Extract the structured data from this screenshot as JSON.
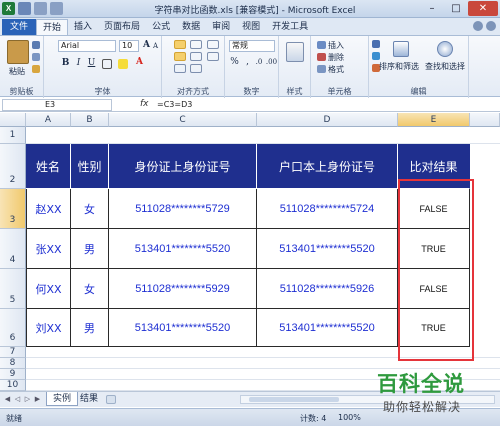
{
  "window": {
    "title": "字符串对比函数.xls [兼容模式] - Microsoft Excel",
    "quick_access": [
      "save-icon",
      "undo-icon",
      "redo-icon"
    ]
  },
  "ribbon_tabs": [
    "文件",
    "开始",
    "插入",
    "页面布局",
    "公式",
    "数据",
    "审阅",
    "视图",
    "开发工具"
  ],
  "ribbon": {
    "paste_label": "粘贴",
    "clipboard_label": "剪贴板",
    "font_name": "Arial",
    "font_size": "10",
    "font_label": "字体",
    "align_label": "对齐方式",
    "number_format": "常规",
    "number_label": "数字",
    "style_label": "样式",
    "insert_label": "插入",
    "delete_label": "删除",
    "format_label": "格式",
    "cells_label": "单元格",
    "sortfilter_label": "排序和筛选",
    "findselect_label": "查找和选择",
    "editing_label": "编辑",
    "bold": "B",
    "italic": "I",
    "underline": "U",
    "font_grow": "A",
    "font_shrink": "A",
    "font_color": "A",
    "currency": "%",
    "comma": ",",
    "decimal_up": ".0",
    "decimal_down": ".00"
  },
  "formula_bar": {
    "name_box": "E3",
    "fx": "fx",
    "formula": "=C3=D3"
  },
  "columns": [
    "A",
    "B",
    "C",
    "D",
    "E"
  ],
  "rows": [
    "1",
    "2",
    "3",
    "4",
    "5",
    "6",
    "7",
    "8",
    "9",
    "10",
    "11"
  ],
  "table": {
    "headers": [
      "姓名",
      "性别",
      "身份证上身份证号",
      "户口本上身份证号",
      "比对结果"
    ],
    "rows": [
      [
        "赵XX",
        "女",
        "511028********5729",
        "511028********5724",
        "FALSE"
      ],
      [
        "张XX",
        "男",
        "513401********5520",
        "513401********5520",
        "TRUE"
      ],
      [
        "何XX",
        "女",
        "511028********5929",
        "511028********5926",
        "FALSE"
      ],
      [
        "刘XX",
        "男",
        "513401********5520",
        "513401********5520",
        "TRUE"
      ]
    ]
  },
  "sheets": [
    "实例",
    "结果"
  ],
  "status": {
    "ready": "就绪",
    "count": "计数: 4",
    "zoom": "100%"
  },
  "watermark": {
    "logo": "百科全说",
    "sub": "助你轻松解决"
  },
  "colors": {
    "header_bg": "#1f2f8e",
    "cell_text": "#1e2fd2",
    "highlight": "#e5343a",
    "file_tab": "#2a63b8"
  }
}
